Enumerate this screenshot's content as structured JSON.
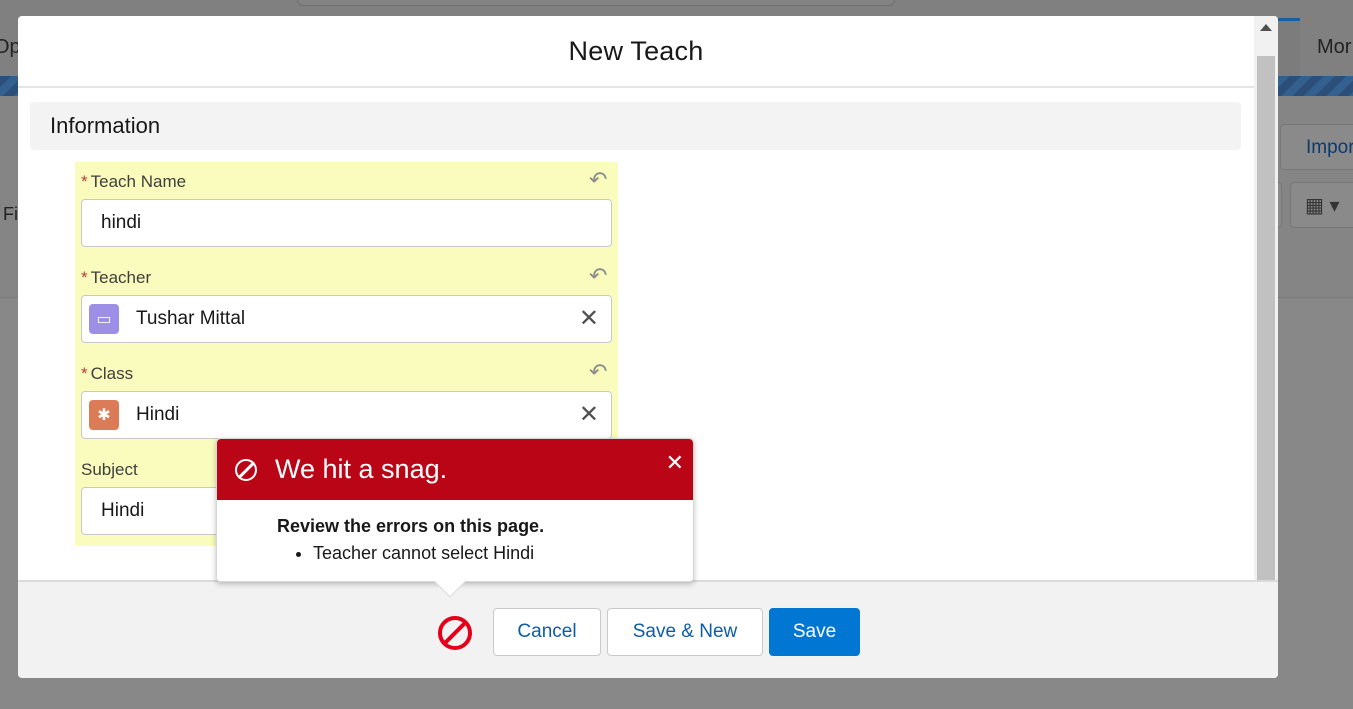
{
  "background": {
    "left_tab_fragment": "Op",
    "right_tab_fragment": "Mor",
    "filter_fragment": "Fil",
    "import_fragment": "Impor"
  },
  "modal": {
    "title": "New Teach",
    "section_title": "Information",
    "fields": {
      "teach_name": {
        "label": "Teach Name",
        "required_marker": "*",
        "value": "hindi"
      },
      "teacher": {
        "label": "Teacher",
        "required_marker": "*",
        "value": "Tushar Mittal",
        "icon": "contact-card-icon",
        "icon_color": "#9d8ee6"
      },
      "class": {
        "label": "Class",
        "required_marker": "*",
        "value": "Hindi",
        "icon": "bug-icon",
        "icon_color": "#db7c57"
      },
      "subject": {
        "label": "Subject",
        "value": "Hindi"
      }
    }
  },
  "error_popover": {
    "title": "We hit a snag.",
    "heading": "Review the errors on this page.",
    "errors": [
      "Teacher cannot select Hindi"
    ],
    "color": "#ba0517"
  },
  "footer": {
    "cancel_label": "Cancel",
    "save_new_label": "Save & New",
    "save_label": "Save",
    "error_icon": "error-ban-icon",
    "brand_color": "#0176d3"
  }
}
